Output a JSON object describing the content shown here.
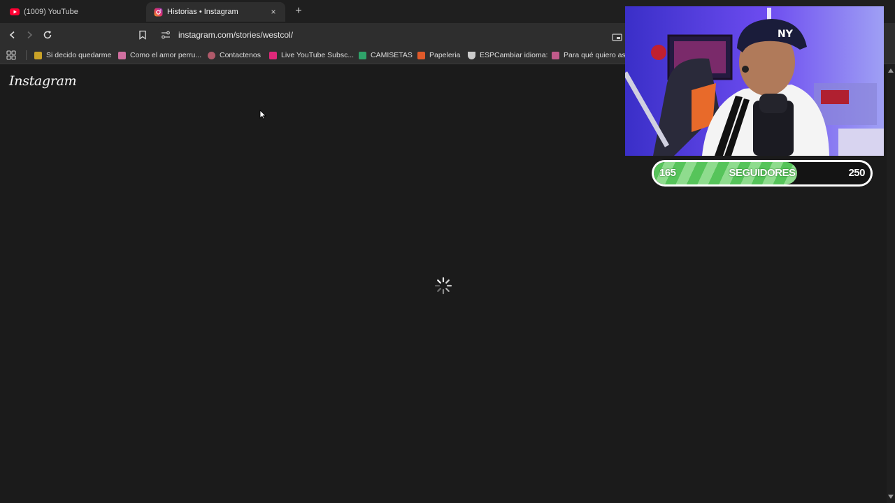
{
  "tabs": [
    {
      "title": "(1009) YouTube",
      "icon": "youtube-icon",
      "active": false
    },
    {
      "title": "Historias • Instagram",
      "icon": "instagram-icon",
      "active": true
    }
  ],
  "tab_close_symbol": "×",
  "new_tab_symbol": "+",
  "address_bar": {
    "url": "instagram.com/stories/westcol/"
  },
  "bookmarks": [
    {
      "label": "Si decido quedarme",
      "icon": "music-icon",
      "color": "#c9a227"
    },
    {
      "label": "Como el amor perru...",
      "icon": "music-icon",
      "color": "#d06fa0"
    },
    {
      "label": "Contactenos",
      "icon": "globe-icon",
      "color": "#b05a6a"
    },
    {
      "label": "Live YouTube Subsc...",
      "icon": "youtube-icon",
      "color": "#e0287a"
    },
    {
      "label": "CAMISETAS",
      "icon": "shop-icon",
      "color": "#2fa36a"
    },
    {
      "label": "Papeleria",
      "icon": "tag-icon",
      "color": "#e05a2a"
    },
    {
      "label": "ESPCambiar idioma:",
      "icon": "bowl-icon",
      "color": "#cccccc"
    },
    {
      "label": "Para qué quiero asp",
      "icon": "music-icon",
      "color": "#c05a8a"
    }
  ],
  "page": {
    "logo": "Instagram",
    "state": "loading"
  },
  "follower_goal": {
    "current": "165",
    "label": "SEGUIDORES",
    "goal": "250",
    "progress": 0.66,
    "fill_color": "#56c45a"
  },
  "colors": {
    "background": "#1b1b1b",
    "chrome": "#2e2e2e",
    "accent": "#56c45a",
    "youtube": "#ff0033"
  }
}
